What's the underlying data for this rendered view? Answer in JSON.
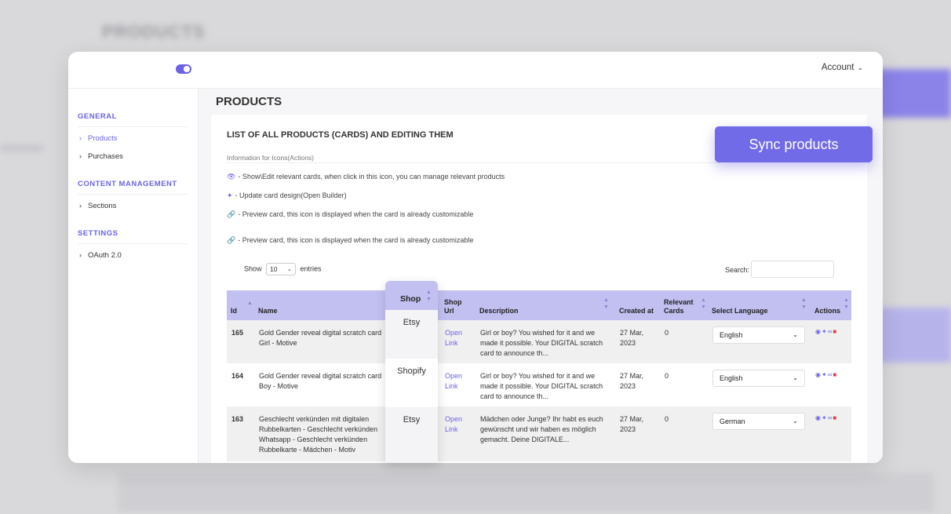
{
  "background": {
    "title": "PRODUCTS"
  },
  "header": {
    "account_label": "Account"
  },
  "sidebar": {
    "sections": [
      {
        "title": "GENERAL",
        "items": [
          "Products",
          "Purchases"
        ]
      },
      {
        "title": "CONTENT MANAGEMENT",
        "items": [
          "Sections"
        ]
      },
      {
        "title": "SETTINGS",
        "items": [
          "OAuth 2.0"
        ]
      }
    ],
    "active_item": "Products"
  },
  "page": {
    "title": "PRODUCTS"
  },
  "card": {
    "title": "LIST OF ALL PRODUCTS (CARDS) AND EDITING THEM",
    "info_header": "Information for Icons(Actions)",
    "info_lines": [
      "- Show\\Edit relevant cards, when click in this icon, you can manage relevant products",
      "- Update card design(Open Builder)",
      "- Preview card, this icon is displayed when the card is already customizable",
      "- Preview card, this icon is displayed when the card is already customizable"
    ]
  },
  "table_controls": {
    "show_label": "Show",
    "entries_value": "10",
    "entries_label": "entries",
    "search_label": "Search:",
    "search_value": ""
  },
  "table": {
    "columns": [
      "Id",
      "Name",
      "Shop",
      "Shop Url",
      "Description",
      "Created at",
      "Relevant Cards",
      "Select Language",
      "Actions"
    ],
    "rows": [
      {
        "id": "165",
        "name": [
          "Gold Gender reveal digital scratch card",
          "Girl - Motive"
        ],
        "shop": "Etsy",
        "shop_url": [
          "Open",
          "Link"
        ],
        "description": [
          "Girl or boy? You wished for it and we",
          "made it possible. Your DIGITAL scratch",
          "card to announce th..."
        ],
        "created_at": [
          "27 Mar,",
          "2023"
        ],
        "relevant_cards": "0",
        "language": "English"
      },
      {
        "id": "164",
        "name": [
          "Gold Gender reveal digital scratch card",
          "Boy - Motive"
        ],
        "shop": "Shopify",
        "shop_url": [
          "Open",
          "Link"
        ],
        "description": [
          "Girl or boy? You wished for it and we",
          "made it possible. Your DIGITAL scratch",
          "card to announce th..."
        ],
        "created_at": [
          "27 Mar,",
          "2023"
        ],
        "relevant_cards": "0",
        "language": "English"
      },
      {
        "id": "163",
        "name": [
          "Geschlecht verkünden mit digitalen",
          "Rubbelkarten - Geschlecht verkünden",
          "Whatsapp - Geschlecht verkünden",
          "Rubbelkarte - Mädchen - Motiv"
        ],
        "shop": "Etsy",
        "shop_url": [
          "Open",
          "Link"
        ],
        "description": [
          "Mädchen oder Junge? Ihr habt es euch",
          "gewünscht und wir haben es möglich",
          "gemacht. Deine DIGITALE..."
        ],
        "created_at": [
          "27 Mar,",
          "2023"
        ],
        "relevant_cards": "0",
        "language": "German"
      }
    ]
  },
  "sync_button": {
    "label": "Sync products"
  },
  "colors": {
    "accent": "#6b63e6",
    "table_header": "#c2c0f1",
    "delete": "#e04040"
  },
  "icons": [
    "eye-icon",
    "wand-icon",
    "link-icon",
    "trash-icon",
    "chevron-down-icon",
    "toggle-switch"
  ]
}
